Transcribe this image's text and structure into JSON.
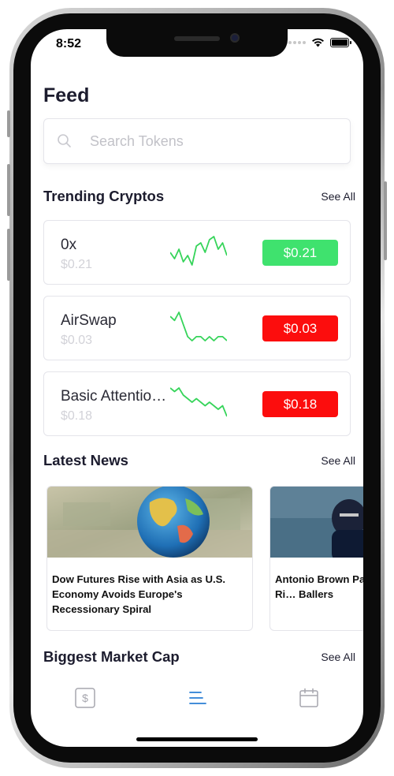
{
  "status_bar": {
    "time": "8:52"
  },
  "page": {
    "title": "Feed"
  },
  "search": {
    "placeholder": "Search Tokens"
  },
  "trending": {
    "title": "Trending Cryptos",
    "see_all": "See All",
    "items": [
      {
        "name": "0x",
        "sub_price": "$0.21",
        "price": "$0.21",
        "status_color": "#3fe26e",
        "trend": [
          6,
          8,
          5,
          9,
          7,
          10,
          4,
          3,
          6,
          2,
          1,
          5,
          3,
          7
        ]
      },
      {
        "name": "AirSwap",
        "sub_price": "$0.03",
        "price": "$0.03",
        "status_color": "#fc0d0d",
        "trend": [
          3,
          4,
          2,
          5,
          8,
          9,
          8,
          8,
          9,
          8,
          9,
          8,
          8,
          9
        ]
      },
      {
        "name": "Basic Attentio…",
        "sub_price": "$0.18",
        "price": "$0.18",
        "status_color": "#fc0d0d",
        "trend": [
          2,
          3,
          2,
          4,
          5,
          6,
          5,
          6,
          7,
          6,
          7,
          8,
          7,
          10
        ]
      }
    ]
  },
  "news": {
    "title": "Latest News",
    "see_all": "See All",
    "items": [
      {
        "headline": "Dow Futures Rise with Asia as U.S. Economy Avoids Europe's Recessionary Spiral",
        "image": "globe-on-money"
      },
      {
        "headline": "Antonio Brown Pa… Confirms He Is Ri… Ballers",
        "image": "football-player"
      }
    ]
  },
  "market_cap": {
    "title": "Biggest Market Cap",
    "see_all": "See All"
  },
  "tabs": [
    {
      "name": "portfolio",
      "icon": "dollar-icon",
      "active": false
    },
    {
      "name": "feed",
      "icon": "menu-icon",
      "active": true
    },
    {
      "name": "calendar",
      "icon": "calendar-icon",
      "active": false
    }
  ],
  "colors": {
    "accent": "#2a7fd4",
    "up": "#3fe26e",
    "down": "#fc0d0d",
    "spark": "#36d45a"
  }
}
